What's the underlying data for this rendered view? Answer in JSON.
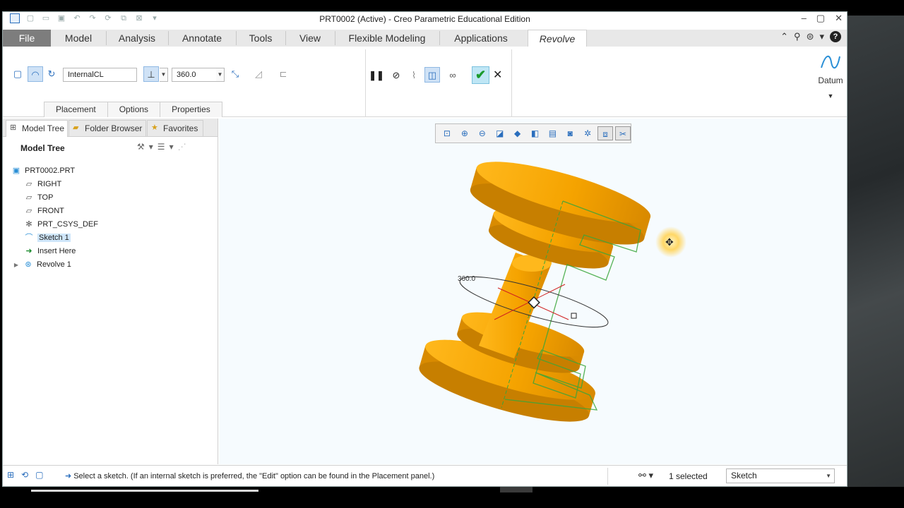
{
  "window": {
    "title": "PRT0002 (Active) - Creo Parametric Educational Edition"
  },
  "ribbon": {
    "tabs": [
      "File",
      "Model",
      "Analysis",
      "Annotate",
      "Tools",
      "View",
      "Flexible Modeling",
      "Applications",
      "Revolve"
    ],
    "active_tab": "Revolve"
  },
  "dashboard": {
    "axis_field": "InternalCL",
    "angle_value": "360.0",
    "subtabs": [
      "Placement",
      "Options",
      "Properties"
    ],
    "datum_label": "Datum"
  },
  "panel": {
    "tabs": [
      "Model Tree",
      "Folder Browser",
      "Favorites"
    ],
    "tree_header": "Model Tree",
    "nodes": [
      {
        "label": "PRT0002.PRT",
        "icon": "part-icon"
      },
      {
        "label": "RIGHT",
        "icon": "datum-plane-icon"
      },
      {
        "label": "TOP",
        "icon": "datum-plane-icon"
      },
      {
        "label": "FRONT",
        "icon": "datum-plane-icon"
      },
      {
        "label": "PRT_CSYS_DEF",
        "icon": "csys-icon"
      },
      {
        "label": "Sketch 1",
        "icon": "sketch-icon"
      },
      {
        "label": "Insert Here",
        "icon": "insert-arrow-icon"
      },
      {
        "label": "Revolve 1",
        "icon": "revolve-icon"
      }
    ],
    "selected_node": "Sketch 1"
  },
  "graphics": {
    "angle_annotation": "360.0",
    "model_color": "#f5a800",
    "sketch_color": "#3aa63a"
  },
  "status": {
    "message": "Select a sketch. (If an internal sketch is preferred, the \"Edit\" option can be found in the Placement panel.)",
    "selection_count": "1 selected",
    "filter": "Sketch"
  },
  "colors": {
    "accent": "#2a6ebd",
    "ok_green": "#1a9a2c",
    "file_tab": "#7d7d7d"
  }
}
